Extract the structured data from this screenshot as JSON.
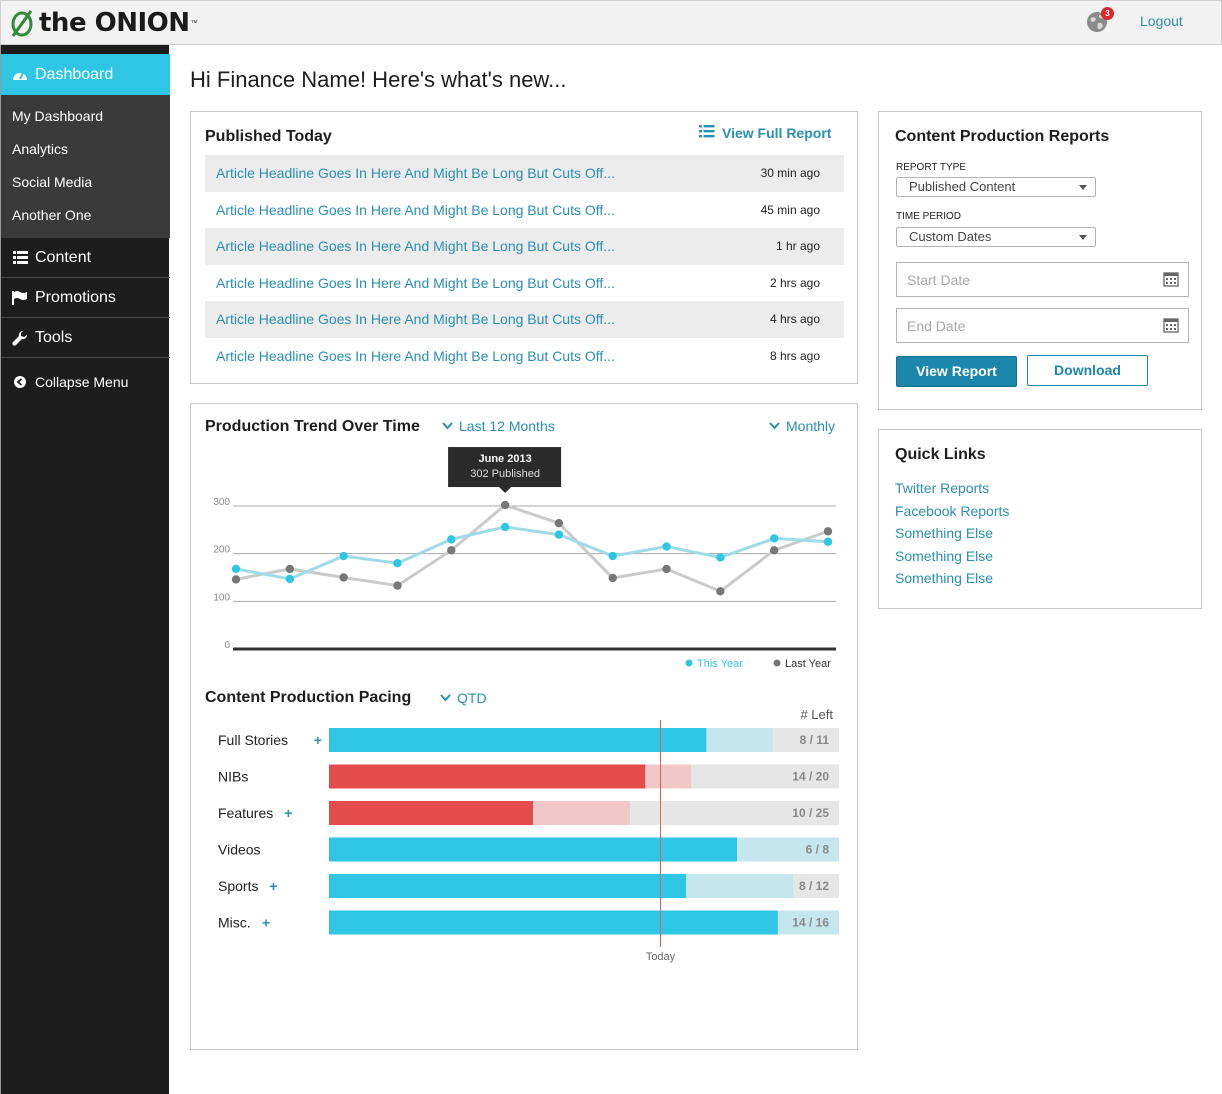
{
  "header": {
    "brand": "the ONION",
    "trademark": "™",
    "notification_count": "3",
    "logout_label": "Logout"
  },
  "sidebar": {
    "dashboard_label": "Dashboard",
    "sub_items": [
      "My Dashboard",
      "Analytics",
      "Social Media",
      "Another One"
    ],
    "content_label": "Content",
    "promotions_label": "Promotions",
    "tools_label": "Tools",
    "collapse_label": "Collapse Menu"
  },
  "greeting": "Hi Finance Name! Here's what's new...",
  "published_today": {
    "title": "Published Today",
    "view_full_report_label": "View Full Report",
    "articles": [
      {
        "headline": "Article Headline Goes In Here And Might Be Long But Cuts Off...",
        "time": "30 min ago"
      },
      {
        "headline": "Article Headline Goes In Here And Might Be Long But Cuts Off...",
        "time": "45 min ago"
      },
      {
        "headline": "Article Headline Goes In Here And Might Be Long But Cuts Off...",
        "time": "1 hr ago"
      },
      {
        "headline": "Article Headline Goes In Here And Might Be Long But Cuts Off...",
        "time": "2 hrs ago"
      },
      {
        "headline": "Article Headline Goes In Here And Might Be Long But Cuts Off...",
        "time": "4 hrs ago"
      },
      {
        "headline": "Article Headline Goes In Here And Might Be Long But Cuts Off...",
        "time": "8 hrs ago"
      }
    ]
  },
  "trend": {
    "title": "Production Trend Over Time",
    "range_label": "Last 12 Months",
    "interval_label": "Monthly"
  },
  "pacing": {
    "title": "Content Production Pacing",
    "range_label": "QTD"
  },
  "reports": {
    "title": "Content Production Reports",
    "report_type_label": "REPORT TYPE",
    "report_type_value": "Published Content",
    "time_period_label": "TIME PERIOD",
    "time_period_value": "Custom Dates",
    "start_date_placeholder": "Start Date",
    "end_date_placeholder": "End Date",
    "view_report_label": "View Report",
    "download_label": "Download"
  },
  "quick_links": {
    "title": "Quick Links",
    "links": [
      "Twitter Reports",
      "Facebook Reports",
      "Something Else",
      "Something Else",
      "Something Else"
    ]
  },
  "colors": {
    "accent": "#2fc6e6",
    "link": "#2a8fb5",
    "button": "#1b87ad",
    "this_year": "#2fc6e6",
    "last_year": "#777777",
    "behind": "#e44b4b",
    "sidebar_bg": "#1d1d1d"
  },
  "chart_data": [
    {
      "type": "line",
      "categories": [
        "",
        "",
        "",
        "",
        "",
        "",
        "",
        "",
        "",
        "",
        "",
        ""
      ],
      "series": [
        {
          "name": "This Year",
          "values": [
            168,
            147,
            195,
            180,
            230,
            256,
            240,
            195,
            215,
            192,
            232,
            225
          ]
        },
        {
          "name": "Last Year",
          "values": [
            146,
            168,
            150,
            133,
            207,
            302,
            264,
            149,
            168,
            121,
            207,
            247
          ]
        }
      ],
      "ylim": [
        0,
        300
      ],
      "yticks": [
        "0",
        "100",
        "200",
        "300"
      ],
      "grid": true,
      "legend": "bottom-right",
      "tooltip": {
        "title": "June 2013",
        "text": "302 Published",
        "index": 5,
        "series": 1
      }
    },
    {
      "type": "bar",
      "subtype": "horizontal-pacing",
      "column_header": "# Left",
      "today_label": "Today",
      "categories": [
        "Full Stories",
        "NIBs",
        "Features",
        "Videos",
        "Sports",
        "Misc."
      ],
      "expandable": [
        true,
        false,
        true,
        false,
        true,
        true
      ],
      "published": [
        0.74,
        0.62,
        0.4,
        0.8,
        0.7,
        0.88
      ],
      "projected": [
        0.87,
        0.71,
        0.59,
        1.0,
        0.91,
        1.0
      ],
      "behind_pace": [
        false,
        true,
        true,
        false,
        false,
        false
      ],
      "labels": [
        "8 / 11",
        "14 / 20",
        "10 / 25",
        "6 / 8",
        "8 / 12",
        "14 / 16"
      ],
      "today_position": 0.65
    }
  ]
}
